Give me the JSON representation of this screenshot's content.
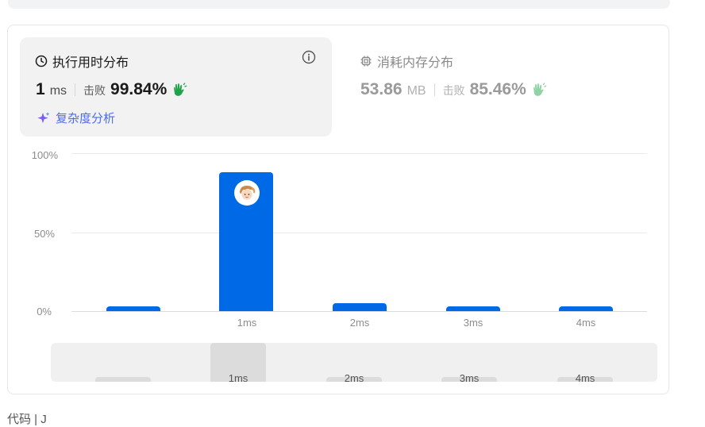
{
  "runtime": {
    "title": "执行用时分布",
    "value": "1",
    "unit": "ms",
    "beat_label": "击败",
    "beat_value": "99.84%",
    "complexity_link": "复杂度分析"
  },
  "memory": {
    "title": "消耗内存分布",
    "value": "53.86",
    "unit": "MB",
    "beat_label": "击败",
    "beat_value": "85.46%"
  },
  "icons": {
    "runtime_title": "clock-icon",
    "memory_title": "chip-icon",
    "info": "info-icon",
    "beat": "clapping-hands-icon",
    "complexity": "sparkle-icon"
  },
  "colors": {
    "bar": "#0069e6",
    "accent_link": "#4a6cf7",
    "clap_runtime": "#1fa34a",
    "clap_memory": "#8fd3a4"
  },
  "chart_data": {
    "type": "bar",
    "categories": [
      "",
      "1ms",
      "2ms",
      "3ms",
      "4ms"
    ],
    "values": [
      3,
      88,
      5,
      3,
      3
    ],
    "yticks": [
      "100%",
      "50%",
      "0%"
    ],
    "ylim": [
      0,
      100
    ],
    "highlighted_category": "1ms"
  },
  "mini_chart": {
    "labels": [
      "",
      "1ms",
      "2ms",
      "3ms",
      "4ms"
    ],
    "values": [
      3,
      88,
      5,
      3,
      3
    ]
  },
  "footer_text": "代码 | J"
}
